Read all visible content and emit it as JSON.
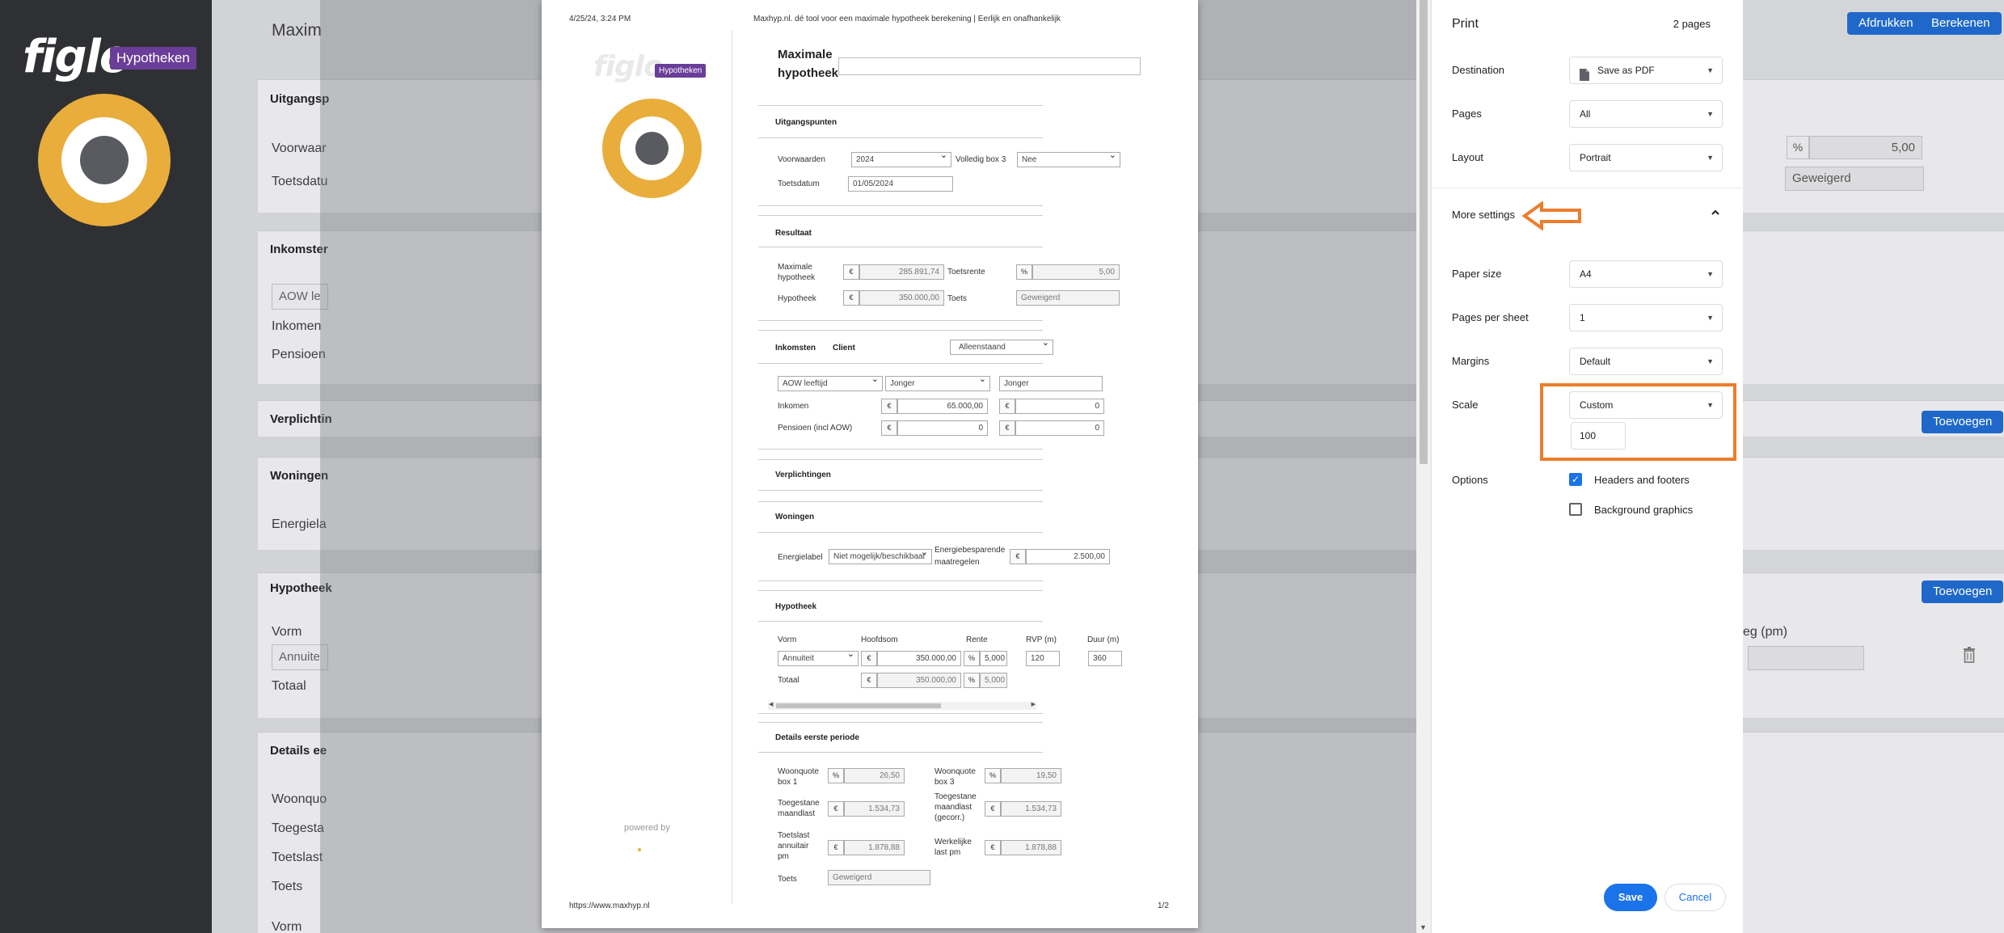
{
  "app": {
    "logo_text": "figlo",
    "logo_badge": "Hypotheken",
    "title": "Maxim",
    "header_buttons": {
      "print": "Afdrukken",
      "calculate": "Berekenen"
    },
    "left_labels": [
      "Uitgangsp",
      "Voorwaar",
      "Toetsdatu",
      "Inkomster",
      "AOW le",
      "Inkomen",
      "Pensioen",
      "Verplichtin",
      "Woningen",
      "Energiela",
      "Hypotheek",
      "Vorm",
      "Annuite",
      "Totaal",
      "Details ee",
      "Woonquo",
      "Toegesta",
      "Toetslast",
      "Toets",
      "Vorm"
    ],
    "right": {
      "pct_prefix": "%",
      "rate_value": "5,00",
      "status": "Geweigerd",
      "add_button": "Toevoegen",
      "add_button_2": "Toevoegen",
      "col_header": "eg (pm)",
      "trash_icon": "trash-icon"
    }
  },
  "doc": {
    "header_left": "4/25/24, 3:24 PM",
    "header_center": "Maxhyp.nl. dé tool voor een maximale hypotheek berekening | Eerlijk en onafhankelijk",
    "logo_text": "figlo",
    "logo_badge": "Hypotheken",
    "title_line1": "Maximale",
    "title_line2": "hypotheek",
    "powered_by": "powered by",
    "footer_left": "https://www.maxhyp.nl",
    "footer_right": "1/2",
    "uitgangspunten": {
      "heading": "Uitgangspunten",
      "voorwaarden_label": "Voorwaarden",
      "voorwaarden_value": "2024",
      "box3_label": "Volledig box 3",
      "box3_value": "Nee",
      "toetsdatum_label": "Toetsdatum",
      "toetsdatum_value": "01/05/2024"
    },
    "resultaat": {
      "heading": "Resultaat",
      "max_label_1": "Maximale",
      "max_label_2": "hypotheek",
      "max_value": "285.891,74",
      "toetsrente_label": "Toetsrente",
      "toetsrente_value": "5,00",
      "hypotheek_label": "Hypotheek",
      "hypotheek_value": "350.000,00",
      "toets_label": "Toets",
      "toets_value": "Geweigerd"
    },
    "inkomsten": {
      "heading": "Inkomsten",
      "client": "Client",
      "status": "Alleenstaand",
      "aow": "AOW leeftijd",
      "jonger1": "Jonger",
      "jonger2": "Jonger",
      "inkomen_label": "Inkomen",
      "inkomen_value": "65.000,00",
      "inkomen_value2": "0",
      "pensioen_label": "Pensioen (incl AOW)",
      "pensioen_value": "0",
      "pensioen_value2": "0"
    },
    "verplichtingen": {
      "heading": "Verplichtingen"
    },
    "woningen": {
      "heading": "Woningen",
      "energielabel_label": "Energielabel",
      "energielabel_value": "Niet mogelijk/beschikbaar",
      "besparend_1": "Energiebesparende",
      "besparend_2": "maatregelen",
      "besparend_value": "2.500,00"
    },
    "hypotheek": {
      "heading": "Hypotheek",
      "cols": [
        "Vorm",
        "Hoofdsom",
        "Rente",
        "RVP (m)",
        "Duur (m)"
      ],
      "vorm": "Annuiteit",
      "hoofdsom": "350.000,00",
      "rente": "5,000",
      "rvp": "120",
      "duur": "360",
      "totaal_label": "Totaal",
      "totaal_value": "350.000,00",
      "totaal_rente": "5,000"
    },
    "details": {
      "heading": "Details eerste periode",
      "woonquote1_a": "Woonquote",
      "woonquote1_b": "box 1",
      "woonquote1_value": "26,50",
      "woonquote3_a": "Woonquote",
      "woonquote3_b": "box 3",
      "woonquote3_value": "19,50",
      "toeg_a": "Toegestane",
      "toeg_b": "maandlast",
      "toeg_value": "1.534,73",
      "toegc_a": "Toegestane",
      "toegc_b": "maandlast",
      "toegc_c": "(gecorr.)",
      "toegc_value": "1.534,73",
      "toetslast_a": "Toetslast",
      "toetslast_b": "annuitair",
      "toetslast_c": "pm",
      "toetslast_value": "1.878,88",
      "werkelijke_a": "Werkelijke",
      "werkelijke_b": "last pm",
      "werkelijke_value": "1.878,88",
      "toets_label": "Toets",
      "toets_value": "Geweigerd"
    },
    "currency": "€",
    "percent": "%"
  },
  "print_dialog": {
    "title": "Print",
    "pages_count": "2 pages",
    "destination_label": "Destination",
    "destination_value": "Save as PDF",
    "pages_label": "Pages",
    "pages_value": "All",
    "layout_label": "Layout",
    "layout_value": "Portrait",
    "more_settings": "More settings",
    "paper_label": "Paper size",
    "paper_value": "A4",
    "pps_label": "Pages per sheet",
    "pps_value": "1",
    "margins_label": "Margins",
    "margins_value": "Default",
    "scale_label": "Scale",
    "scale_value": "Custom",
    "scale_input": "100",
    "options_label": "Options",
    "headers_footers": "Headers and footers",
    "headers_footers_checked": true,
    "background_graphics": "Background graphics",
    "background_graphics_checked": false,
    "save": "Save",
    "cancel": "Cancel",
    "accent_color": "#1a73e8",
    "highlight_color": "#ec7d2c"
  }
}
